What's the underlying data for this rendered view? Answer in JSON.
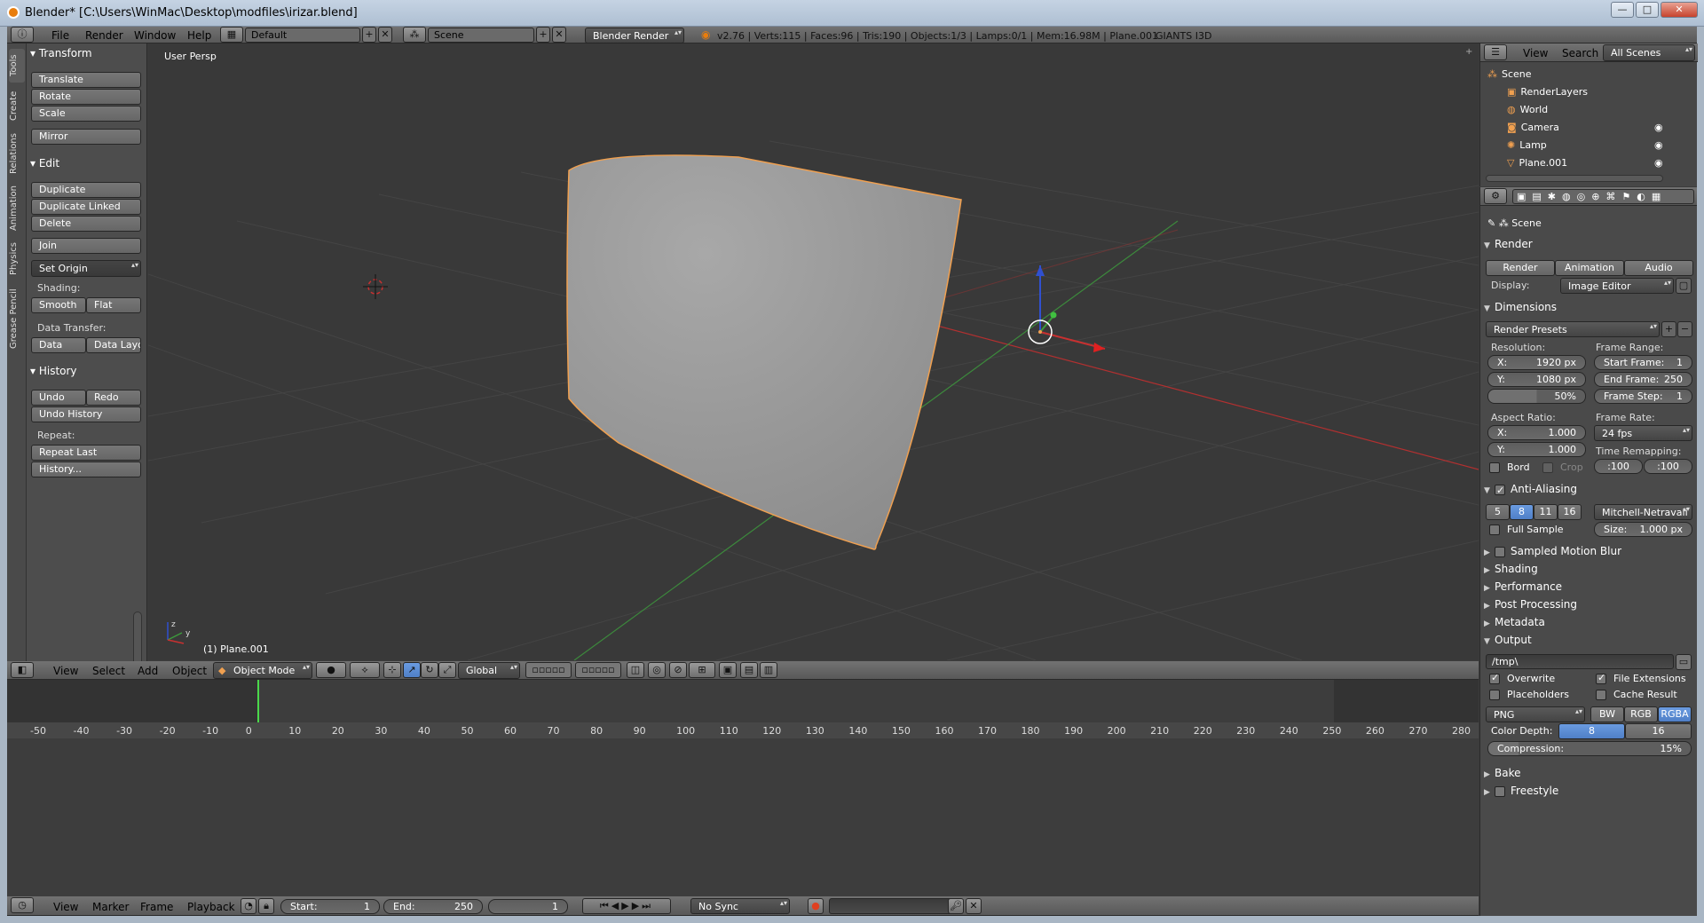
{
  "window": {
    "title": "Blender* [C:\\Users\\WinMac\\Desktop\\modfiles\\irizar.blend]",
    "minimize": "—",
    "maximize": "□",
    "close": "✕"
  },
  "top_header": {
    "menus": [
      "File",
      "Render",
      "Window",
      "Help"
    ],
    "layout": "Default",
    "scene": "Scene",
    "engine": "Blender Render",
    "stats": "v2.76 | Verts:115 | Faces:96 | Tris:190 | Objects:1/3 | Lamps:0/1 | Mem:16.98M | Plane.001",
    "extra": "GIANTS I3D"
  },
  "toolshelf": {
    "tabs": [
      "Tools",
      "Create",
      "Relations",
      "Animation",
      "Physics",
      "Grease Pencil"
    ],
    "transform": {
      "title": "Transform",
      "buttons": [
        "Translate",
        "Rotate",
        "Scale",
        "Mirror"
      ]
    },
    "edit": {
      "title": "Edit",
      "buttons": [
        "Duplicate",
        "Duplicate Linked",
        "Delete",
        "Join"
      ],
      "set_origin": "Set Origin",
      "shading_label": "Shading:",
      "shading": [
        "Smooth",
        "Flat"
      ],
      "data_transfer_label": "Data Transfer:",
      "data_transfer": [
        "Data",
        "Data Layo"
      ]
    },
    "history": {
      "title": "History",
      "undo": "Undo",
      "redo": "Redo",
      "undo_history": "Undo History",
      "repeat_label": "Repeat:",
      "repeat_last": "Repeat Last",
      "history": "History..."
    }
  },
  "viewport": {
    "view_name": "User Persp",
    "object_label": "(1) Plane.001",
    "axis_y": "y",
    "axis_z": "z"
  },
  "viewport_header": {
    "menus": [
      "View",
      "Select",
      "Add",
      "Object"
    ],
    "mode": "Object Mode",
    "orientation": "Global"
  },
  "timeline": {
    "ruler": [
      "-50",
      "-40",
      "-30",
      "-20",
      "-10",
      "0",
      "10",
      "20",
      "30",
      "40",
      "50",
      "60",
      "70",
      "80",
      "90",
      "100",
      "110",
      "120",
      "130",
      "140",
      "150",
      "160",
      "170",
      "180",
      "190",
      "200",
      "210",
      "220",
      "230",
      "240",
      "250",
      "260",
      "270",
      "280"
    ],
    "menus": [
      "View",
      "Marker",
      "Frame",
      "Playback"
    ],
    "start_label": "Start:",
    "start_value": "1",
    "end_label": "End:",
    "end_value": "250",
    "current": "1",
    "sync": "No Sync"
  },
  "outliner": {
    "menus": [
      "View",
      "Search"
    ],
    "filter": "All Scenes",
    "items": [
      {
        "label": "Scene",
        "indent": 0
      },
      {
        "label": "RenderLayers",
        "indent": 1
      },
      {
        "label": "World",
        "indent": 1
      },
      {
        "label": "Camera",
        "indent": 1
      },
      {
        "label": "Lamp",
        "indent": 1
      },
      {
        "label": "Plane.001",
        "indent": 1
      }
    ]
  },
  "properties": {
    "context": "Scene",
    "render_section": "Render",
    "render_buttons": [
      "Render",
      "Animation",
      "Audio"
    ],
    "display_label": "Display:",
    "display_value": "Image Editor",
    "dimensions": "Dimensions",
    "render_presets": "Render Presets",
    "resolution_label": "Resolution:",
    "res_x_label": "X:",
    "res_x": "1920 px",
    "res_y_label": "Y:",
    "res_y": "1080 px",
    "res_pct": "50%",
    "frame_range_label": "Frame Range:",
    "start_frame_label": "Start Frame:",
    "start_frame": "1",
    "end_frame_label": "End Frame:",
    "end_frame": "250",
    "frame_step_label": "Frame Step:",
    "frame_step": "1",
    "aspect_label": "Aspect Ratio:",
    "aspect_x": "1.000",
    "aspect_y": "1.000",
    "frame_rate_label": "Frame Rate:",
    "frame_rate": "24 fps",
    "time_remap_label": "Time Remapping:",
    "remap_old": ":100",
    "remap_new": ":100",
    "bord": "Bord",
    "crop": "Crop",
    "anti_aliasing": "Anti-Aliasing",
    "aa_samples": [
      "5",
      "8",
      "11",
      "16"
    ],
    "aa_selected": "8",
    "aa_filter": "Mitchell-Netravali",
    "full_sample": "Full Sample",
    "size_label": "Size:",
    "size_value": "1.000 px",
    "sampled_motion_blur": "Sampled Motion Blur",
    "shading": "Shading",
    "performance": "Performance",
    "post_processing": "Post Processing",
    "metadata": "Metadata",
    "output": "Output",
    "output_path": "/tmp\\",
    "overwrite": "Overwrite",
    "file_extensions": "File Extensions",
    "placeholders": "Placeholders",
    "cache_result": "Cache Result",
    "file_format": "PNG",
    "color_modes": [
      "BW",
      "RGB",
      "RGBA"
    ],
    "color_mode_selected": "RGBA",
    "color_depth_label": "Color Depth:",
    "color_depths": [
      "8",
      "16"
    ],
    "color_depth_selected": "8",
    "compression_label": "Compression:",
    "compression": "15%",
    "bake": "Bake",
    "freestyle": "Freestyle"
  },
  "colors": {
    "selection_outline": "#f0a050",
    "active_blue": "#5680c2",
    "x_axis": "#c83030",
    "y_axis": "#3c9a3c",
    "z_axis": "#3050d0"
  }
}
